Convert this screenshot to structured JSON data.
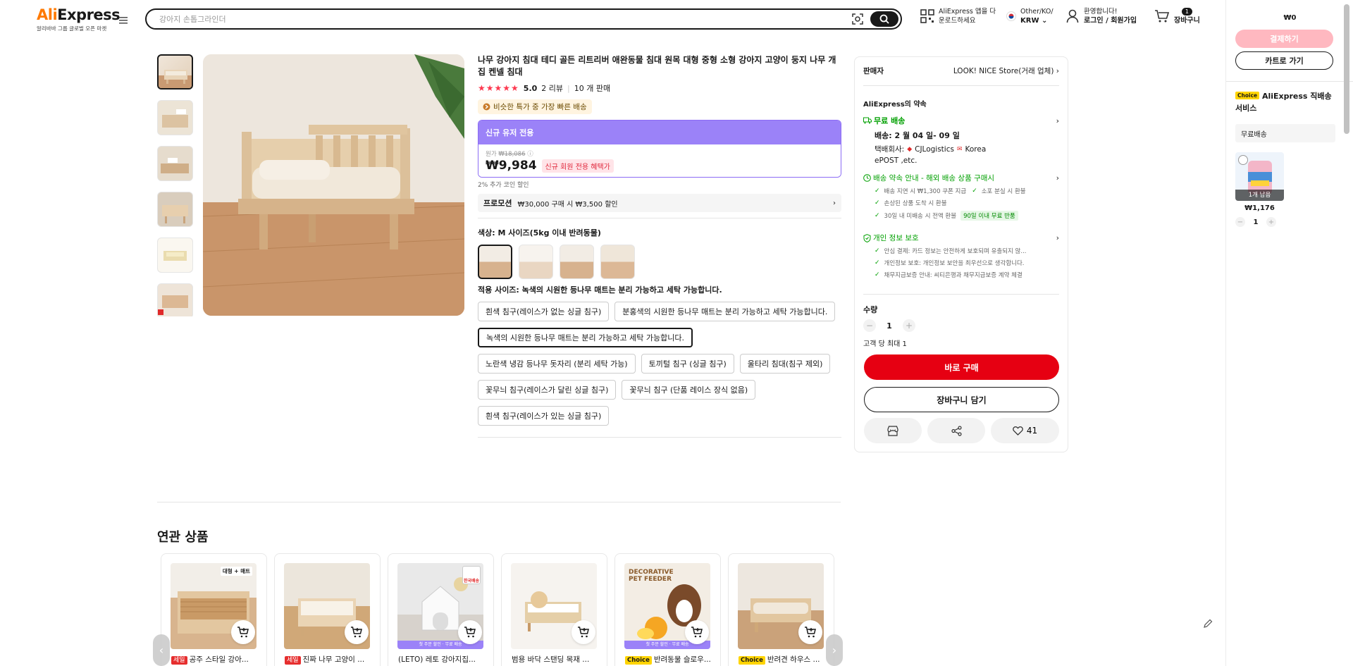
{
  "header": {
    "logo_text_ali": "Ali",
    "logo_text_express": "Express",
    "logo_sub": "알리바바 그룹 글로벌 오픈 마켓",
    "search_placeholder": "강아지 손톱그라인더",
    "app_line1": "AliExpress 앱을 다",
    "app_line2": "운로드하세요",
    "locale_line1": "Other/KO/",
    "locale_line2": "KRW",
    "account_line1": "환영합니다!",
    "account_line2": "로그인 / 회원가입",
    "cart_count": "1",
    "cart_label": "장바구니"
  },
  "product": {
    "title": "나무 강아지 침대 테디 골든 리트리버 애완동물 침대 원목 대형 중형 소형 강아지 고양이 둥지 나무 개집 켄넬 침대",
    "stars": "★★★★★",
    "rating": "5.0",
    "reviews": "2 리뷰",
    "sold": "10 개 판매",
    "fast_badge": "비슷한 특가 중 가장 빠른 배송",
    "new_user_header": "신규 유저 전용",
    "orig_label": "원가",
    "orig_price": "₩18,086",
    "price": "₩9,984",
    "price_tag": "신규 회원 전용 혜택가",
    "coin_note": "2% 추가 코인 할인",
    "promo_label": "프로모션",
    "promo_text": "₩30,000 구매 시 ₩3,500 할인",
    "color_label": "색상: M 사이즈(5kg 이내 반려동물)",
    "size_label": "적용 사이즈: 녹색의 시원한 등나무 매트는 분리 가능하고 세탁 가능합니다.",
    "options": [
      "흰색 침구(레이스가 없는 싱글 침구)",
      "분홍색의 시원한 등나무 매트는 분리 가능하고 세탁 가능합니다.",
      "녹색의 시원한 등나무 매트는 분리 가능하고 세탁 가능합니다.",
      "노란색 냉감 등나무 돗자리 (분리 세탁 가능)",
      "토끼털 침구 (싱글 침구)",
      "울타리 침대(침구 제외)",
      "꽃무늬 침구(레이스가 달린 싱글 침구)",
      "꽃무늬 침구 (단품 레이스 장식 없음)",
      "흰색 침구(레이스가 있는 싱글 침구)"
    ]
  },
  "panel": {
    "seller_label": "판매자",
    "seller_name": "LOOK! NICE Store(거래 업체)",
    "promise_title": "AliExpress의 약속",
    "free_shipping": "무료 배송",
    "delivery_date": "배송: 2 월 04 일- 09 일",
    "courier_line1": "택배회사:",
    "courier_line1b": "CJLogistics",
    "courier_line1c": "Korea",
    "courier_line2": "ePOST ,etc.",
    "guarantee_title": "배송 약속 안내 - 해외 배송 상품 구매시",
    "g1": "배송 지연 시 ₩1,300 쿠폰 지급",
    "g2": "소포 분실 시 환불",
    "g3": "손상된 상품 도착 시 환불",
    "g4": "30일 내 미배송 시 전액 환불",
    "g4_badge": "90일 이내 무료 반품",
    "privacy_title": "개인 정보 보호",
    "p1": "안심 결제: 카드 정보는 안전하게 보호되며 유출되지 않...",
    "p2": "개인정보 보호: 개인정보 보안을 최우선으로 생각합니다.",
    "p3": "채무지급보증 안내: 씨티은행과 채무지급보증 계약 체결",
    "qty_label": "수량",
    "qty_value": "1",
    "qty_limit": "고객 당 최대 1",
    "buy_now": "바로 구매",
    "add_cart": "장바구니 담기",
    "wish_count": "41"
  },
  "related": {
    "title": "연관 상품",
    "items": [
      {
        "tag": "세일",
        "tag_type": "sale",
        "name": "공주 스타일 강아...",
        "badge": "대형 + 매트"
      },
      {
        "tag": "세일",
        "tag_type": "sale",
        "name": "진짜 나무 고양이 ...",
        "badge": ""
      },
      {
        "tag": "",
        "tag_type": "",
        "name": "(LETO) 레토 강아지집...",
        "badge": "한국배송",
        "strip": "첫 주문 할인 · 무료 배송"
      },
      {
        "tag": "",
        "tag_type": "",
        "name": "범용 바닥 스탠딩 목재 ...",
        "badge": ""
      },
      {
        "tag": "Choice",
        "tag_type": "choice",
        "name": "반려동물 슬로우...",
        "badge": "DECORATIVE PET FEEDER",
        "strip": "첫 주문 할인 · 무료 배송"
      },
      {
        "tag": "Choice",
        "tag_type": "choice",
        "name": "반려견 하우스 ...",
        "badge": ""
      }
    ]
  },
  "sidebar": {
    "total": "₩0",
    "checkout": "결제하기",
    "go_cart": "카트로 가기",
    "choice_tag": "Choice",
    "choice_title": "AliExpress 직배송 서비스",
    "free_ship": "무료배송",
    "stock_left": "1개 남음",
    "item_price": "₩1,176",
    "item_qty": "1"
  },
  "colors": {
    "brand_red": "#e60012",
    "new_user_purple": "#9b82f8",
    "promise_green": "#00a000",
    "checkout_pink": "#ffb8c0"
  }
}
